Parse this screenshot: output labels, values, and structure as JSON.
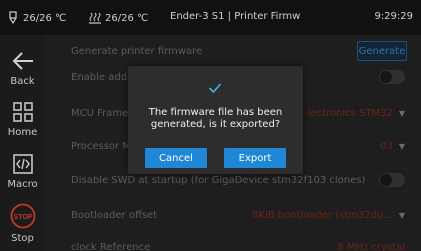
{
  "status": {
    "nozzle_temp": "26/26 ℃",
    "bed_temp": "26/26 ℃",
    "printer_name": "Ender-3 S1 | Printer Firmw",
    "time": "9:29:29"
  },
  "sidebar": {
    "items": [
      {
        "label": "Back",
        "icon": "arrow-left-icon"
      },
      {
        "label": "Home",
        "icon": "grid-icon"
      },
      {
        "label": "Macro",
        "icon": "code-icon"
      },
      {
        "label": "Stop",
        "icon": "stop-icon",
        "icon_text": "STOP"
      }
    ]
  },
  "content": {
    "rows": [
      {
        "label": "Generate printer firmware",
        "button": "Generate"
      },
      {
        "label": "Enable addit",
        "type": "toggle"
      },
      {
        "label": "MCU Frame",
        "value": "lectronics STM32"
      },
      {
        "label": "Processor M",
        "value": "03"
      },
      {
        "label": "Disable SWD at startup (for GigaDevice stm32f103 clones)",
        "type": "toggle"
      },
      {
        "label": "Bootloader offset",
        "value": "8KiB bootloader (stm32du..."
      },
      {
        "label": "clock Reference",
        "value": "8 MHz crystal"
      }
    ]
  },
  "dialog": {
    "message": "The firmware file has been generated, is it exported?",
    "cancel_label": "Cancel",
    "export_label": "Export"
  },
  "colors": {
    "accent": "#1e88d6",
    "stop": "#c0392b",
    "check": "#45b4e8"
  }
}
